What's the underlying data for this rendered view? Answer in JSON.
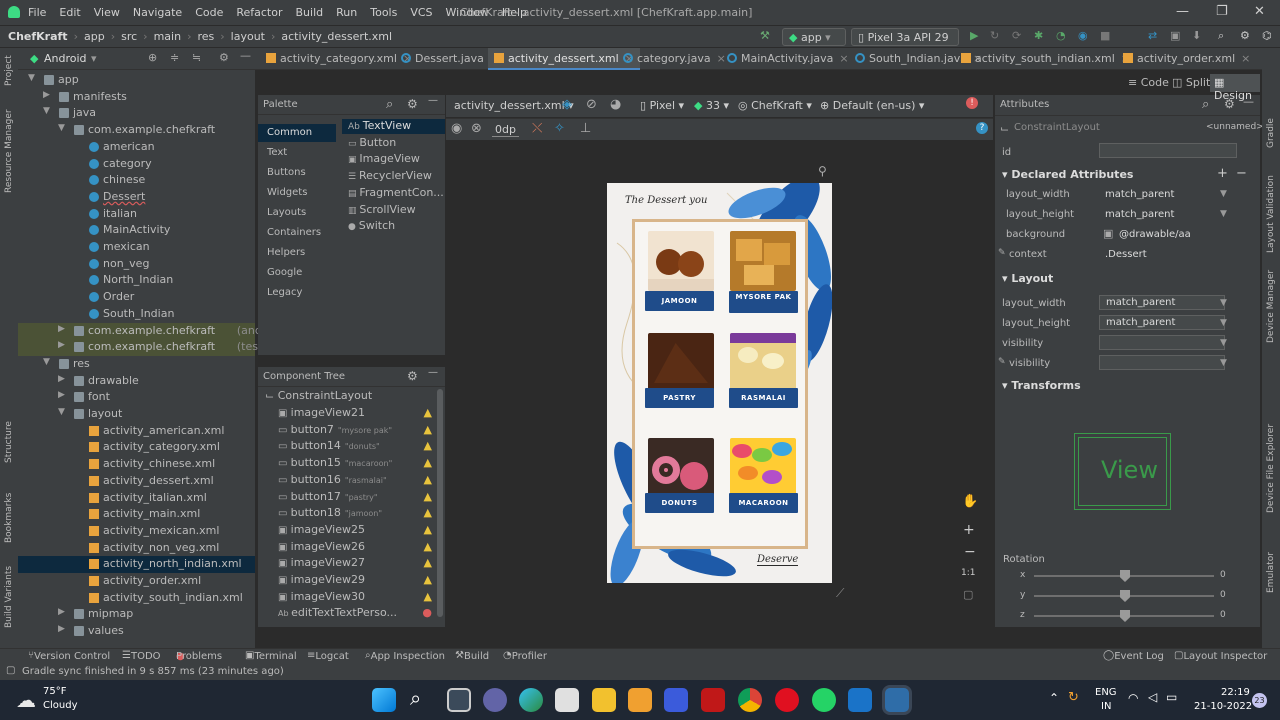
{
  "window": {
    "title": "ChefKraft - activity_dessert.xml [ChefKraft.app.main]",
    "menu": [
      "File",
      "Edit",
      "View",
      "Navigate",
      "Code",
      "Refactor",
      "Build",
      "Run",
      "Tools",
      "VCS",
      "Window",
      "Help"
    ]
  },
  "breadcrumb": [
    "ChefKraft",
    "app",
    "src",
    "main",
    "res",
    "layout",
    "activity_dessert.xml"
  ],
  "toolbar": {
    "run_config": "app",
    "device": "Pixel 3a API 29"
  },
  "tabs": [
    "activity_category.xml",
    "Dessert.java",
    "activity_dessert.xml",
    "category.java",
    "MainActivity.java",
    "South_Indian.java",
    "activity_south_indian.xml",
    "activity_order.xml"
  ],
  "project": {
    "view_mode": "Android",
    "items": [
      {
        "label": "app",
        "level": 0,
        "type": "folder",
        "arrow": "open"
      },
      {
        "label": "manifests",
        "level": 1,
        "type": "folder",
        "arrow": "closed"
      },
      {
        "label": "java",
        "level": 1,
        "type": "folder",
        "arrow": "open"
      },
      {
        "label": "com.example.chefkraft",
        "level": 2,
        "type": "folder",
        "arrow": "open"
      },
      {
        "label": "american",
        "level": 3,
        "type": "class"
      },
      {
        "label": "category",
        "level": 3,
        "type": "class"
      },
      {
        "label": "chinese",
        "level": 3,
        "type": "class"
      },
      {
        "label": "Dessert",
        "level": 3,
        "type": "class",
        "underline": true
      },
      {
        "label": "italian",
        "level": 3,
        "type": "class"
      },
      {
        "label": "MainActivity",
        "level": 3,
        "type": "class"
      },
      {
        "label": "mexican",
        "level": 3,
        "type": "class"
      },
      {
        "label": "non_veg",
        "level": 3,
        "type": "class"
      },
      {
        "label": "North_Indian",
        "level": 3,
        "type": "class"
      },
      {
        "label": "Order",
        "level": 3,
        "type": "class"
      },
      {
        "label": "South_Indian",
        "level": 3,
        "type": "class"
      },
      {
        "label": "com.example.chefkraft",
        "suffix": "(androidTest)",
        "level": 2,
        "type": "folder",
        "arrow": "closed",
        "test": true
      },
      {
        "label": "com.example.chefkraft",
        "suffix": "(test)",
        "level": 2,
        "type": "folder",
        "arrow": "closed",
        "test": true
      },
      {
        "label": "res",
        "level": 1,
        "type": "folder",
        "arrow": "open"
      },
      {
        "label": "drawable",
        "level": 2,
        "type": "folder",
        "arrow": "closed"
      },
      {
        "label": "font",
        "level": 2,
        "type": "folder",
        "arrow": "closed"
      },
      {
        "label": "layout",
        "level": 2,
        "type": "folder",
        "arrow": "open"
      },
      {
        "label": "activity_american.xml",
        "level": 3,
        "type": "xml"
      },
      {
        "label": "activity_category.xml",
        "level": 3,
        "type": "xml"
      },
      {
        "label": "activity_chinese.xml",
        "level": 3,
        "type": "xml"
      },
      {
        "label": "activity_dessert.xml",
        "level": 3,
        "type": "xml"
      },
      {
        "label": "activity_italian.xml",
        "level": 3,
        "type": "xml"
      },
      {
        "label": "activity_main.xml",
        "level": 3,
        "type": "xml"
      },
      {
        "label": "activity_mexican.xml",
        "level": 3,
        "type": "xml"
      },
      {
        "label": "activity_non_veg.xml",
        "level": 3,
        "type": "xml"
      },
      {
        "label": "activity_north_indian.xml",
        "level": 3,
        "type": "xml",
        "selected": true
      },
      {
        "label": "activity_order.xml",
        "level": 3,
        "type": "xml"
      },
      {
        "label": "activity_south_indian.xml",
        "level": 3,
        "type": "xml"
      },
      {
        "label": "mipmap",
        "level": 2,
        "type": "folder",
        "arrow": "closed"
      },
      {
        "label": "values",
        "level": 2,
        "type": "folder",
        "arrow": "closed"
      }
    ]
  },
  "left_strip": [
    "Project",
    "Resource Manager",
    "Structure",
    "Bookmarks",
    "Build Variants"
  ],
  "palette": {
    "title": "Palette",
    "categories": [
      "Common",
      "Text",
      "Buttons",
      "Widgets",
      "Layouts",
      "Containers",
      "Helpers",
      "Google",
      "Legacy"
    ],
    "items": [
      "TextView",
      "Button",
      "ImageView",
      "RecyclerView",
      "FragmentCon...",
      "ScrollView",
      "Switch"
    ]
  },
  "component_tree": {
    "title": "Component Tree",
    "root": "ConstraintLayout",
    "items": [
      {
        "label": "imageView21",
        "hint": "",
        "status": "warn",
        "icon": "image"
      },
      {
        "label": "button7",
        "hint": "\"mysore pak\"",
        "status": "warn",
        "icon": "button"
      },
      {
        "label": "button14",
        "hint": "\"donuts\"",
        "status": "warn",
        "icon": "button"
      },
      {
        "label": "button15",
        "hint": "\"macaroon\"",
        "status": "warn",
        "icon": "button"
      },
      {
        "label": "button16",
        "hint": "\"rasmalai\"",
        "status": "warn",
        "icon": "button"
      },
      {
        "label": "button17",
        "hint": "\"pastry\"",
        "status": "warn",
        "icon": "button"
      },
      {
        "label": "button18",
        "hint": "\"jamoon\"",
        "status": "warn",
        "icon": "button"
      },
      {
        "label": "imageView25",
        "hint": "",
        "status": "warn",
        "icon": "image"
      },
      {
        "label": "imageView26",
        "hint": "",
        "status": "warn",
        "icon": "image"
      },
      {
        "label": "imageView27",
        "hint": "",
        "status": "warn",
        "icon": "image"
      },
      {
        "label": "imageView29",
        "hint": "",
        "status": "warn",
        "icon": "image"
      },
      {
        "label": "imageView30",
        "hint": "",
        "status": "warn",
        "icon": "image"
      },
      {
        "label": "editTextTextPerso...",
        "hint": "",
        "status": "error",
        "icon": "text"
      }
    ]
  },
  "design_toolbar": {
    "file": "activity_dessert.xml",
    "device": "Pixel",
    "api": "33",
    "theme": "ChefKraft",
    "locale": "Default (en-us)",
    "margin": "0dp"
  },
  "phone": {
    "header_text": "The Dessert you",
    "footer_text": "Deserve",
    "items": [
      "JAMOON",
      "MYSORE PAK",
      "PASTRY",
      "RASMALAI",
      "DONUTS",
      "MACAROON"
    ]
  },
  "view_modes": [
    "Code",
    "Split",
    "Design"
  ],
  "attributes": {
    "title": "Attributes",
    "component": "ConstraintLayout",
    "component_name": "<unnamed>",
    "id_label": "id",
    "declared_title": "Declared Attributes",
    "declared": [
      {
        "name": "layout_width",
        "value": "match_parent"
      },
      {
        "name": "layout_height",
        "value": "match_parent"
      },
      {
        "name": "background",
        "value": "@drawable/aa"
      },
      {
        "name": "context",
        "value": ".Dessert"
      }
    ],
    "layout_title": "Layout",
    "layout": [
      {
        "name": "layout_width",
        "value": "match_parent"
      },
      {
        "name": "layout_height",
        "value": "match_parent"
      },
      {
        "name": "visibility",
        "value": ""
      },
      {
        "name": "visibility",
        "value": ""
      }
    ],
    "transforms_title": "Transforms",
    "preview_label": "View",
    "rotation_label": "Rotation",
    "rotation": [
      {
        "axis": "x",
        "value": "0"
      },
      {
        "axis": "y",
        "value": "0"
      },
      {
        "axis": "z",
        "value": "0"
      }
    ]
  },
  "right_strip": [
    "Gradle",
    "Layout Validation",
    "Device Manager",
    "Device File Explorer",
    "Emulator"
  ],
  "bottom_tools": [
    "Version Control",
    "TODO",
    "Problems",
    "Terminal",
    "Logcat",
    "App Inspection",
    "Build",
    "Profiler"
  ],
  "bottom_right_tools": [
    "Event Log",
    "Layout Inspector"
  ],
  "status": "Gradle sync finished in 9 s 857 ms (23 minutes ago)",
  "taskbar": {
    "weather_temp": "75°F",
    "weather_desc": "Cloudy",
    "lang": "ENG",
    "region": "IN",
    "time": "22:19",
    "date": "21-10-2022",
    "badge": "23"
  }
}
